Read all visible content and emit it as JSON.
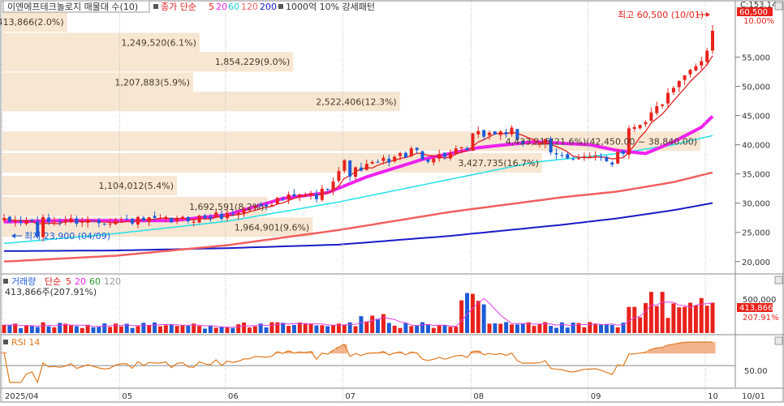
{
  "header": {
    "stock_label": "이엔에프테크놀로지 매물대 수(10)",
    "ma_legend_prefix": "종가 단순",
    "ma_periods": [
      "5",
      "20",
      "60",
      "120",
      "200"
    ],
    "pattern_label": "1000억 10% 강세패턴"
  },
  "colors": {
    "up": "#e8221b",
    "down": "#1e5bd6",
    "ma5": "#e02020",
    "ma20": "#ee22ee",
    "ma60": "#22e0e8",
    "ma120": "#f06060",
    "ma200": "#1a1ac8",
    "band": "#f6e6d2",
    "bg": "#ffffff",
    "axis_bg": "#ffffff"
  },
  "chart_data": [
    {
      "type": "candlestick",
      "title": "이엔에프테크놀로지 매물대 수(10)",
      "ylim": [
        19000,
        62000
      ],
      "yticks": [
        "55,000",
        "50,000",
        "45,000",
        "40,000",
        "35,000",
        "30,000",
        "25,000",
        "20,000"
      ],
      "ytick_values": [
        55000,
        50000,
        45000,
        40000,
        35000,
        30000,
        25000,
        20000
      ],
      "xticks": [
        "2025/04",
        "05",
        "06",
        "07",
        "08",
        "09",
        "10"
      ],
      "xtick_start": "2025-04-01",
      "session_count": 128,
      "xtick_sessions": [
        0,
        21,
        40,
        61,
        84,
        105,
        126
      ],
      "last_value_box": "60,500",
      "right_top_labels": [
        "C:153.14",
        "10.00%"
      ],
      "annotations": {
        "high": "최고 60,500 (10/01)",
        "low": "최저 23,900 (04/09)",
        "high_value": 60500,
        "low_value": 23900
      },
      "volume_profile": [
        {
          "label": "413,866(2.0%)",
          "price": 61000,
          "width_pct": 2.0
        },
        {
          "label": "1,249,520(6.1%)",
          "price": 57500,
          "width_pct": 6.1
        },
        {
          "label": "1,854,229(9.0%)",
          "price": 54200,
          "width_pct": 9.0
        },
        {
          "label": "1,207,883(5.9%)",
          "price": 50700,
          "width_pct": 5.9
        },
        {
          "label": "2,522,406(12.3%)",
          "price": 47400,
          "width_pct": 12.3
        },
        {
          "label": "4,433,215(21.6%)",
          "display_label": "4,433,215(21.6%)(42,450.00 ~ 38,840.00)",
          "price": 40600,
          "width_pct": 21.6
        },
        {
          "label": "3,427,735(16.7%)",
          "price": 36900,
          "width_pct": 16.7
        },
        {
          "label": "1,104,012(5.4%)",
          "price": 33000,
          "width_pct": 5.4
        },
        {
          "label": "1,692,591(8.2%)",
          "price": 29400,
          "width_pct": 8.2
        },
        {
          "label": "1,964,901(9.6%)",
          "price": 25900,
          "width_pct": 9.6
        }
      ],
      "ma_lines": {
        "ma20": [
          [
            0,
            26800
          ],
          [
            10,
            27000
          ],
          [
            20,
            27000
          ],
          [
            30,
            27000
          ],
          [
            40,
            28000
          ],
          [
            50,
            30800
          ],
          [
            58,
            31800
          ],
          [
            65,
            34500
          ],
          [
            75,
            37500
          ],
          [
            85,
            39500
          ],
          [
            95,
            40500
          ],
          [
            105,
            40000
          ],
          [
            110,
            39000
          ],
          [
            115,
            38500
          ],
          [
            120,
            40500
          ],
          [
            125,
            43000
          ],
          [
            128,
            45800
          ]
        ],
        "ma60": [
          [
            0,
            23100
          ],
          [
            20,
            24800
          ],
          [
            40,
            26900
          ],
          [
            60,
            30200
          ],
          [
            80,
            34100
          ],
          [
            95,
            37000
          ],
          [
            110,
            38500
          ],
          [
            120,
            40000
          ],
          [
            128,
            41800
          ]
        ],
        "ma120": [
          [
            0,
            20000
          ],
          [
            20,
            21000
          ],
          [
            40,
            22800
          ],
          [
            60,
            25400
          ],
          [
            80,
            28500
          ],
          [
            100,
            31000
          ],
          [
            110,
            32000
          ],
          [
            120,
            33600
          ],
          [
            128,
            35500
          ]
        ],
        "ma200": [
          [
            0,
            21800
          ],
          [
            20,
            21900
          ],
          [
            40,
            22300
          ],
          [
            60,
            22900
          ],
          [
            80,
            24400
          ],
          [
            100,
            26300
          ],
          [
            110,
            27400
          ],
          [
            120,
            28800
          ],
          [
            128,
            30200
          ]
        ]
      }
    },
    {
      "type": "bar",
      "title": "거래량",
      "legend_label": "거래량",
      "legend_ma_prefix": "단순",
      "legend_ma_periods": [
        "5",
        "20",
        "60",
        "120"
      ],
      "info_label": "413,866주(207.91%)",
      "ytick": "500,000",
      "ytick_value": 500000,
      "ylim": [
        0,
        650000
      ],
      "last_value_box": "413,866",
      "last_pct": "207.91%",
      "last_volume": 413866
    },
    {
      "type": "line",
      "title": "RSI 14",
      "legend_label": "RSI 14",
      "ytick": "50.00",
      "ytick_value": 50,
      "ylim": [
        20,
        90
      ]
    }
  ]
}
